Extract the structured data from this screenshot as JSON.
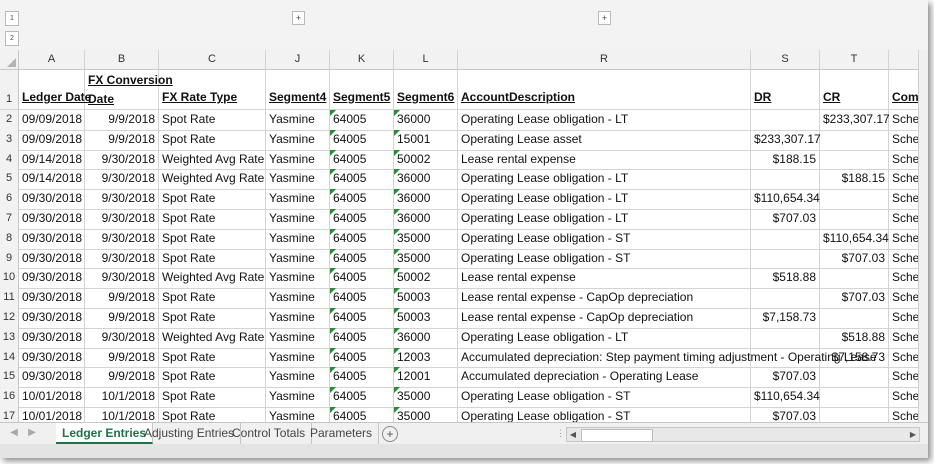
{
  "outline": {
    "level1": "1",
    "level2": "2",
    "expand": "+"
  },
  "columns": [
    "A",
    "B",
    "C",
    "J",
    "K",
    "L",
    "R",
    "S",
    "T"
  ],
  "header_row": {
    "num": "1",
    "cells": [
      "Ledger Date",
      "Date",
      "FX Rate Type",
      "Segment4",
      "Segment5",
      "Segment6",
      "AccountDescription",
      "DR",
      "CR",
      "Comm"
    ],
    "fx_conversion_line1": "FX Conversion"
  },
  "rows": [
    {
      "num": "2",
      "ledger_date": "09/09/2018",
      "fx_date": "9/9/2018",
      "rate_type": "Spot Rate",
      "seg4": "Yasmine",
      "seg5": "64005",
      "seg6": "36000",
      "desc": "Operating Lease obligation - LT",
      "dr": "",
      "cr": "$233,307.17",
      "comm": "Sched"
    },
    {
      "num": "3",
      "ledger_date": "09/09/2018",
      "fx_date": "9/9/2018",
      "rate_type": "Spot Rate",
      "seg4": "Yasmine",
      "seg5": "64005",
      "seg6": "15001",
      "desc": "Operating Lease asset",
      "dr": "$233,307.17",
      "cr": "",
      "comm": "Sched"
    },
    {
      "num": "4",
      "ledger_date": "09/14/2018",
      "fx_date": "9/30/2018",
      "rate_type": "Weighted Avg Rate",
      "seg4": "Yasmine",
      "seg5": "64005",
      "seg6": "50002",
      "desc": "Lease rental expense",
      "dr": "$188.15",
      "cr": "",
      "comm": "Sched"
    },
    {
      "num": "5",
      "ledger_date": "09/14/2018",
      "fx_date": "9/30/2018",
      "rate_type": "Weighted Avg Rate",
      "seg4": "Yasmine",
      "seg5": "64005",
      "seg6": "36000",
      "desc": "Operating Lease obligation - LT",
      "dr": "",
      "cr": "$188.15",
      "comm": "Sched"
    },
    {
      "num": "6",
      "ledger_date": "09/30/2018",
      "fx_date": "9/30/2018",
      "rate_type": "Spot Rate",
      "seg4": "Yasmine",
      "seg5": "64005",
      "seg6": "36000",
      "desc": "Operating Lease obligation - LT",
      "dr": "$110,654.34",
      "cr": "",
      "comm": "Sched"
    },
    {
      "num": "7",
      "ledger_date": "09/30/2018",
      "fx_date": "9/30/2018",
      "rate_type": "Spot Rate",
      "seg4": "Yasmine",
      "seg5": "64005",
      "seg6": "36000",
      "desc": "Operating Lease obligation - LT",
      "dr": "$707.03",
      "cr": "",
      "comm": "Sched"
    },
    {
      "num": "8",
      "ledger_date": "09/30/2018",
      "fx_date": "9/30/2018",
      "rate_type": "Spot Rate",
      "seg4": "Yasmine",
      "seg5": "64005",
      "seg6": "35000",
      "desc": "Operating Lease obligation - ST",
      "dr": "",
      "cr": "$110,654.34",
      "comm": "Sched"
    },
    {
      "num": "9",
      "ledger_date": "09/30/2018",
      "fx_date": "9/30/2018",
      "rate_type": "Spot Rate",
      "seg4": "Yasmine",
      "seg5": "64005",
      "seg6": "35000",
      "desc": "Operating Lease obligation - ST",
      "dr": "",
      "cr": "$707.03",
      "comm": "Sched"
    },
    {
      "num": "10",
      "ledger_date": "09/30/2018",
      "fx_date": "9/30/2018",
      "rate_type": "Weighted Avg Rate",
      "seg4": "Yasmine",
      "seg5": "64005",
      "seg6": "50002",
      "desc": "Lease rental expense",
      "dr": "$518.88",
      "cr": "",
      "comm": "Sched"
    },
    {
      "num": "11",
      "ledger_date": "09/30/2018",
      "fx_date": "9/9/2018",
      "rate_type": "Spot Rate",
      "seg4": "Yasmine",
      "seg5": "64005",
      "seg6": "50003",
      "desc": "Lease rental expense - CapOp depreciation",
      "dr": "",
      "cr": "$707.03",
      "comm": "Sched"
    },
    {
      "num": "12",
      "ledger_date": "09/30/2018",
      "fx_date": "9/9/2018",
      "rate_type": "Spot Rate",
      "seg4": "Yasmine",
      "seg5": "64005",
      "seg6": "50003",
      "desc": "Lease rental expense - CapOp depreciation",
      "dr": "$7,158.73",
      "cr": "",
      "comm": "Sched"
    },
    {
      "num": "13",
      "ledger_date": "09/30/2018",
      "fx_date": "9/30/2018",
      "rate_type": "Weighted Avg Rate",
      "seg4": "Yasmine",
      "seg5": "64005",
      "seg6": "36000",
      "desc": "Operating Lease obligation - LT",
      "dr": "",
      "cr": "$518.88",
      "comm": "Sched"
    },
    {
      "num": "14",
      "ledger_date": "09/30/2018",
      "fx_date": "9/9/2018",
      "rate_type": "Spot Rate",
      "seg4": "Yasmine",
      "seg5": "64005",
      "seg6": "12003",
      "desc": "Accumulated depreciation: Step payment timing adjustment - Operating Lease",
      "dr": "",
      "cr": "$7,158.73",
      "comm": "Sched"
    },
    {
      "num": "15",
      "ledger_date": "09/30/2018",
      "fx_date": "9/9/2018",
      "rate_type": "Spot Rate",
      "seg4": "Yasmine",
      "seg5": "64005",
      "seg6": "12001",
      "desc": "Accumulated depreciation - Operating Lease",
      "dr": "$707.03",
      "cr": "",
      "comm": "Sched"
    },
    {
      "num": "16",
      "ledger_date": "10/01/2018",
      "fx_date": "10/1/2018",
      "rate_type": "Spot Rate",
      "seg4": "Yasmine",
      "seg5": "64005",
      "seg6": "35000",
      "desc": "Operating Lease obligation - ST",
      "dr": "$110,654.34",
      "cr": "",
      "comm": "Sched"
    },
    {
      "num": "17",
      "ledger_date": "10/01/2018",
      "fx_date": "10/1/2018",
      "rate_type": "Spot Rate",
      "seg4": "Yasmine",
      "seg5": "64005",
      "seg6": "35000",
      "desc": "Operating Lease obligation - ST",
      "dr": "$707.03",
      "cr": "",
      "comm": "Sched"
    }
  ],
  "sheet_tabs": [
    {
      "label": "Ledger Entries",
      "active": true
    },
    {
      "label": "Adjusting Entries",
      "active": false
    },
    {
      "label": "Control Totals",
      "active": false
    },
    {
      "label": "Parameters",
      "active": false
    }
  ],
  "add_sheet": "+",
  "accent_color": "#217346"
}
